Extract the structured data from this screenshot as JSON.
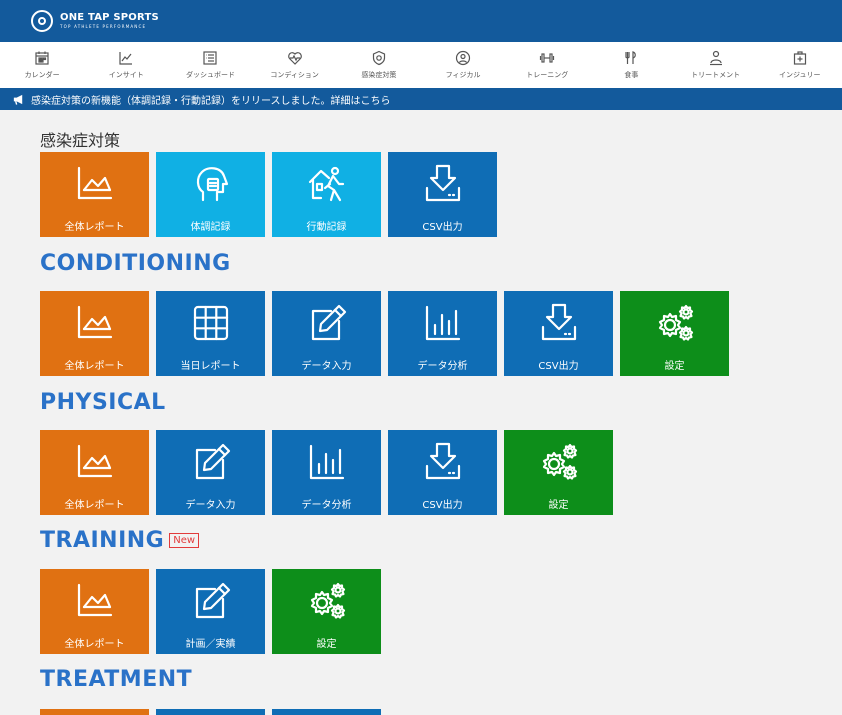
{
  "header": {
    "brand": "ONE TAP SPORTS",
    "tagline": "TOP ATHLETE PERFORMANCE"
  },
  "nav": [
    {
      "label": "カレンダー",
      "icon": "calendar-icon"
    },
    {
      "label": "インサイト",
      "icon": "insight-icon"
    },
    {
      "label": "ダッシュボード",
      "icon": "dashboard-icon"
    },
    {
      "label": "コンディション",
      "icon": "heart-icon"
    },
    {
      "label": "感染症対策",
      "icon": "shield-icon"
    },
    {
      "label": "フィジカル",
      "icon": "person-icon"
    },
    {
      "label": "トレーニング",
      "icon": "dumbbell-icon"
    },
    {
      "label": "食事",
      "icon": "meal-icon"
    },
    {
      "label": "トリートメント",
      "icon": "treatment-icon"
    },
    {
      "label": "インジュリー",
      "icon": "injury-icon"
    }
  ],
  "announcement": "感染症対策の新機能（体調記録・行動記録）をリリースしました。詳細はこちら",
  "sections": {
    "infection": {
      "title": "感染症対策",
      "tiles": [
        {
          "label": "全体レポート",
          "icon": "chart-icon"
        },
        {
          "label": "体調記録",
          "icon": "head-icon"
        },
        {
          "label": "行動記録",
          "icon": "walk-icon"
        },
        {
          "label": "CSV出力",
          "icon": "download-icon"
        }
      ]
    },
    "conditioning": {
      "title": "CONDITIONING",
      "tiles": [
        {
          "label": "全体レポート",
          "icon": "chart-icon"
        },
        {
          "label": "当日レポート",
          "icon": "grid-icon"
        },
        {
          "label": "データ入力",
          "icon": "edit-icon"
        },
        {
          "label": "データ分析",
          "icon": "bar-chart-icon"
        },
        {
          "label": "CSV出力",
          "icon": "download-icon"
        },
        {
          "label": "設定",
          "icon": "gears-icon"
        }
      ]
    },
    "physical": {
      "title": "PHYSICAL",
      "tiles": [
        {
          "label": "全体レポート",
          "icon": "chart-icon"
        },
        {
          "label": "データ入力",
          "icon": "edit-icon"
        },
        {
          "label": "データ分析",
          "icon": "bar-chart-icon"
        },
        {
          "label": "CSV出力",
          "icon": "download-icon"
        },
        {
          "label": "設定",
          "icon": "gears-icon"
        }
      ]
    },
    "training": {
      "title": "TRAINING",
      "badge": "New",
      "tiles": [
        {
          "label": "全体レポート",
          "icon": "chart-icon"
        },
        {
          "label": "計画／実績",
          "icon": "edit-icon"
        },
        {
          "label": "設定",
          "icon": "gears-icon"
        }
      ]
    },
    "treatment": {
      "title": "TREATMENT"
    }
  },
  "colors": {
    "header": "#135a9c",
    "orange": "#e07112",
    "light_blue": "#10b0e4",
    "blue": "#0f6db5",
    "green": "#0d8e1a",
    "title_blue": "#2a72c8"
  }
}
